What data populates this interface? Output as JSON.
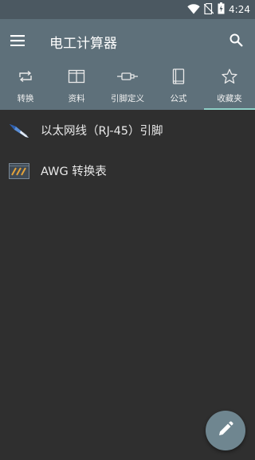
{
  "status_bar": {
    "time": "4:24",
    "icons": [
      "wifi-icon",
      "no-sim-icon",
      "battery-icon"
    ]
  },
  "app_bar": {
    "title": "电工计算器",
    "menu_icon": "menu-icon",
    "search_icon": "search-icon"
  },
  "tabs": [
    {
      "label": "转换",
      "icon": "repeat-icon",
      "active": false
    },
    {
      "label": "资料",
      "icon": "book-open-icon",
      "active": false
    },
    {
      "label": "引脚定义",
      "icon": "connector-icon",
      "active": false
    },
    {
      "label": "公式",
      "icon": "notebook-icon",
      "active": false
    },
    {
      "label": "收藏夹",
      "icon": "star-icon",
      "active": true
    }
  ],
  "favorites": [
    {
      "label": "以太网线（RJ-45）引脚",
      "icon": "ethernet-cable-icon"
    },
    {
      "label": "AWG 转换表",
      "icon": "wire-gauge-icon"
    }
  ],
  "fab": {
    "icon": "pencil-icon"
  },
  "colors": {
    "status_bar": "#4b5861",
    "app_bar": "#5e707a",
    "background": "#2f2f2f",
    "accent": "#8fd1c8",
    "fab": "#6f8690"
  }
}
